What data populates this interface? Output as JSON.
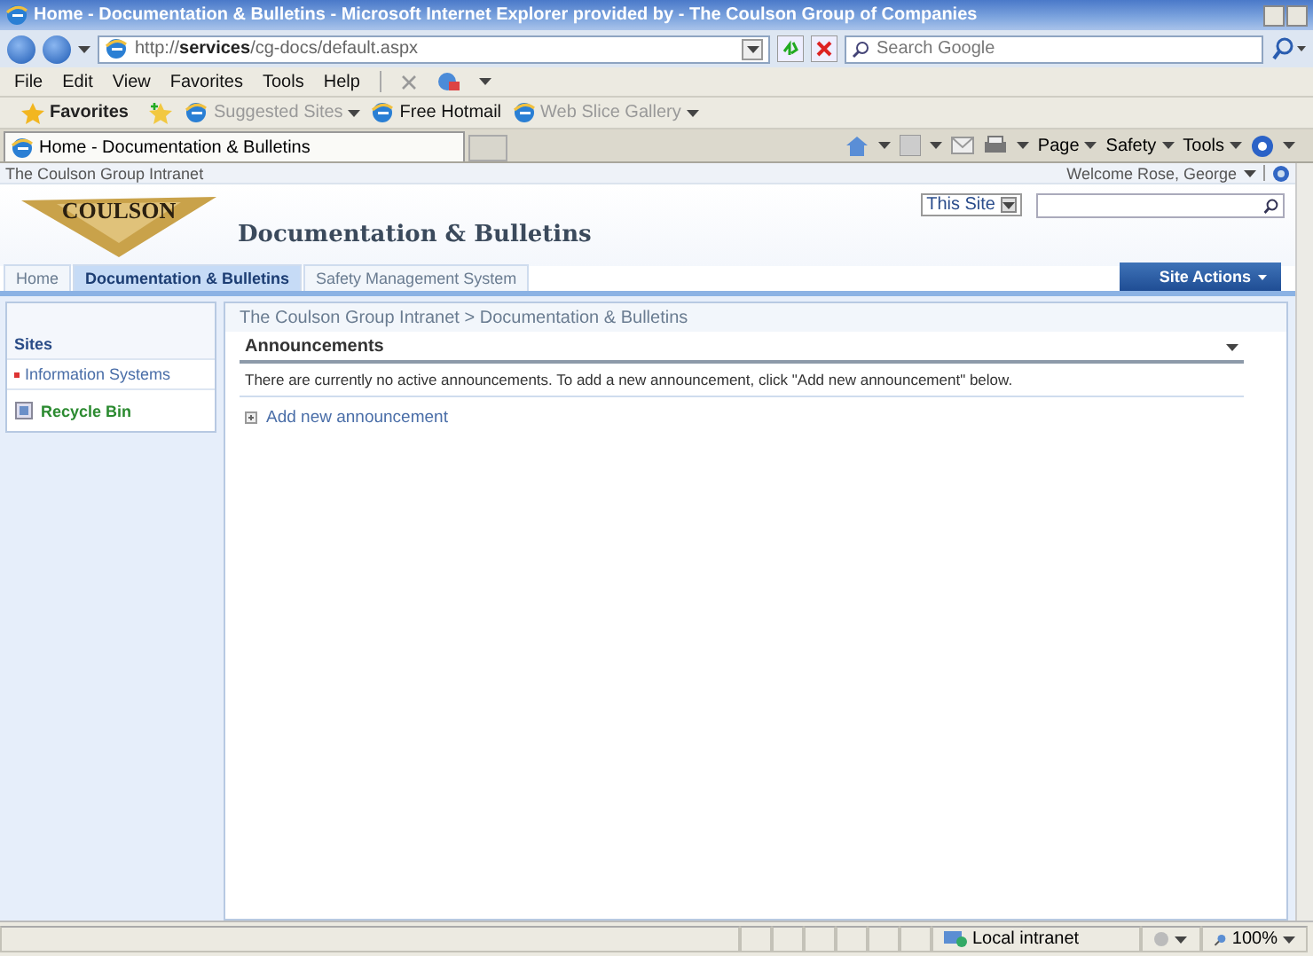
{
  "window": {
    "title": "Home - Documentation & Bulletins - Microsoft Internet Explorer provided by - The Coulson Group of Companies"
  },
  "address_bar": {
    "url": "http://**services**/cg-docs/default.aspx",
    "search_placeholder": "Search Google"
  },
  "menu_bar": [
    "File",
    "Edit",
    "View",
    "Favorites",
    "Tools",
    "Help"
  ],
  "favorites_bar": {
    "label": "Favorites",
    "links": [
      {
        "label": "Suggested Sites",
        "disabled": true,
        "dropdown": true
      },
      {
        "label": "Free Hotmail",
        "disabled": false,
        "dropdown": false
      },
      {
        "label": "Web Slice Gallery",
        "disabled": true,
        "dropdown": true
      }
    ]
  },
  "browser_tabs": [
    {
      "label": "Home - Documentation & Bulletins",
      "selected": true
    }
  ],
  "command_bar": [
    "Page",
    "Safety",
    "Tools"
  ],
  "page": {
    "top_link": "The Coulson Group Intranet",
    "welcome": "Welcome Rose, George",
    "logo": "COULSON",
    "site_title": "Documentation & Bulletins",
    "search_scope": "This Site",
    "nav_tabs": [
      {
        "label": "Home",
        "selected": false
      },
      {
        "label": "Documentation & Bulletins",
        "selected": true
      },
      {
        "label": "Safety Management System",
        "selected": false
      }
    ],
    "site_actions": "Site Actions",
    "sidebar": {
      "heading": "Sites",
      "items": [
        "Information Systems"
      ],
      "recycle_bin": "Recycle Bin"
    },
    "breadcrumb": "The Coulson Group Intranet > Documentation & Bulletins",
    "web_part": {
      "title": "Announcements",
      "message": "There are currently no active announcements. To add a new announcement, click \"Add new announcement\" below.",
      "add_link": "Add new announcement"
    }
  },
  "status_bar": {
    "zone": "Local intranet",
    "zoom": "100%"
  }
}
